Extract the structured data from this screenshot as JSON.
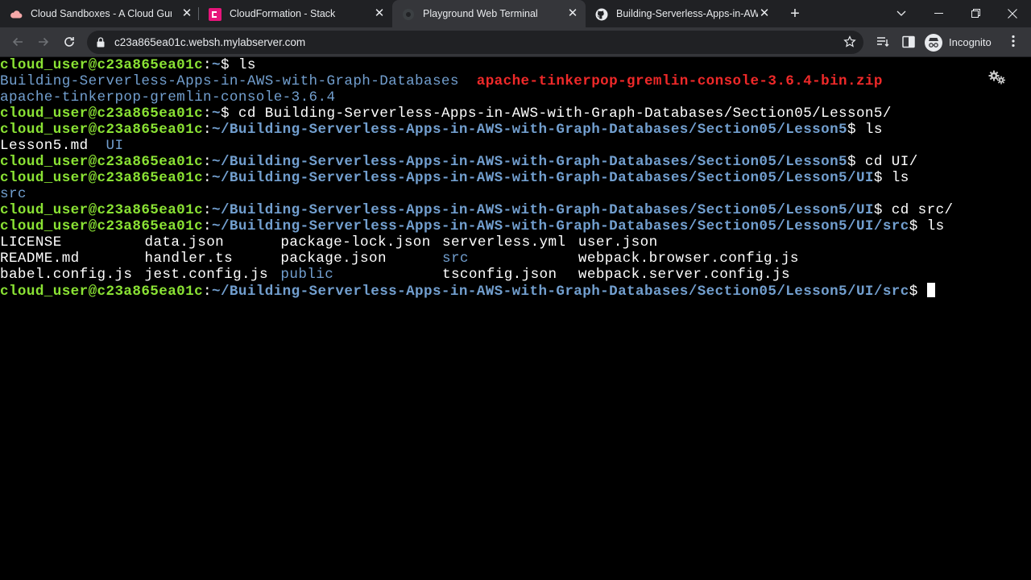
{
  "tabs": [
    {
      "title": "Cloud Sandboxes - A Cloud Guru",
      "icon": "cloud-icon",
      "active": false
    },
    {
      "title": "CloudFormation - Stack",
      "icon": "cloudformation-icon",
      "active": false
    },
    {
      "title": "Playground Web Terminal",
      "icon": "terminal-icon",
      "active": true
    },
    {
      "title": "Building-Serverless-Apps-in-AWS",
      "icon": "github-icon",
      "active": false
    }
  ],
  "toolbar": {
    "url": "c23a865ea01c.websh.mylabserver.com",
    "profile_label": "Incognito"
  },
  "terminal": {
    "lines": [
      {
        "user": "cloud_user@c23a865ea01c",
        "path": "~",
        "cmd": "ls"
      },
      {
        "entries": [
          {
            "text": "Building-Serverless-Apps-in-AWS-with-Graph-Databases",
            "kind": "dir"
          },
          {
            "text": "apache-tinkerpop-gremlin-console-3.6.4-bin.zip",
            "kind": "archive"
          }
        ]
      },
      {
        "entries": [
          {
            "text": "apache-tinkerpop-gremlin-console-3.6.4",
            "kind": "dir"
          }
        ]
      },
      {
        "user": "cloud_user@c23a865ea01c",
        "path": "~",
        "cmd": "cd Building-Serverless-Apps-in-AWS-with-Graph-Databases/Section05/Lesson5/"
      },
      {
        "user": "cloud_user@c23a865ea01c",
        "path": "~/Building-Serverless-Apps-in-AWS-with-Graph-Databases/Section05/Lesson5",
        "cmd": "ls"
      },
      {
        "entries": [
          {
            "text": "Lesson5.md",
            "kind": "file"
          },
          {
            "text": "UI",
            "kind": "dir"
          }
        ]
      },
      {
        "user": "cloud_user@c23a865ea01c",
        "path": "~/Building-Serverless-Apps-in-AWS-with-Graph-Databases/Section05/Lesson5",
        "cmd": "cd UI/"
      },
      {
        "user": "cloud_user@c23a865ea01c",
        "path": "~/Building-Serverless-Apps-in-AWS-with-Graph-Databases/Section05/Lesson5/UI",
        "cmd": "ls"
      },
      {
        "entries": [
          {
            "text": "src",
            "kind": "dir"
          }
        ]
      },
      {
        "user": "cloud_user@c23a865ea01c",
        "path": "~/Building-Serverless-Apps-in-AWS-with-Graph-Databases/Section05/Lesson5/UI",
        "cmd": "cd src/"
      },
      {
        "user": "cloud_user@c23a865ea01c",
        "path": "~/Building-Serverless-Apps-in-AWS-with-Graph-Databases/Section05/Lesson5/UI/src",
        "cmd": "ls"
      },
      {
        "grid": [
          "LICENSE",
          "data.json",
          "package-lock.json",
          "serverless.yml",
          "user.json"
        ],
        "dirs": []
      },
      {
        "grid": [
          "README.md",
          "handler.ts",
          "package.json",
          "src",
          "webpack.browser.config.js"
        ],
        "dirs": [
          "src"
        ]
      },
      {
        "grid": [
          "babel.config.js",
          "jest.config.js",
          "public",
          "tsconfig.json",
          "webpack.server.config.js"
        ],
        "dirs": [
          "public"
        ]
      },
      {
        "user": "cloud_user@c23a865ea01c",
        "path": "~/Building-Serverless-Apps-in-AWS-with-Graph-Databases/Section05/Lesson5/UI/src",
        "cmd": "",
        "cursor": true
      }
    ]
  },
  "colors": {
    "prompt_user": "#8ae234",
    "prompt_path": "#729fcf",
    "directory": "#729fcf",
    "archive": "#ef2929",
    "terminal_bg": "#000000"
  }
}
